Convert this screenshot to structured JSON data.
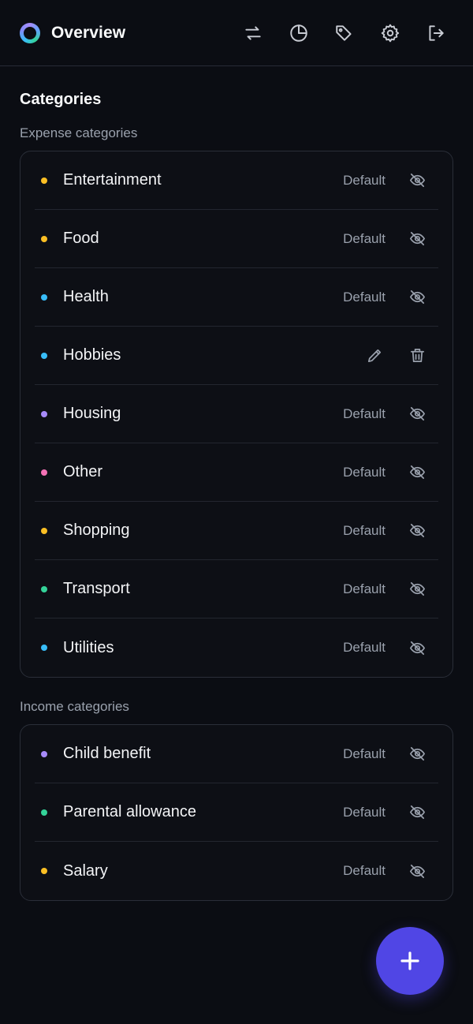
{
  "header": {
    "title": "Overview",
    "icons": [
      "transactions-icon",
      "pie-chart-icon",
      "tag-icon",
      "settings-icon",
      "logout-icon"
    ]
  },
  "page": {
    "title": "Categories"
  },
  "colors": {
    "yellow": "#fbbf24",
    "blue": "#38bdf8",
    "purple": "#a78bfa",
    "pink": "#f472b6",
    "green": "#34d399",
    "accent": "#5046e5"
  },
  "expense": {
    "label": "Expense categories",
    "items": [
      {
        "name": "Entertainment",
        "tag": "Default",
        "color": "#fbbf24",
        "default": true
      },
      {
        "name": "Food",
        "tag": "Default",
        "color": "#fbbf24",
        "default": true
      },
      {
        "name": "Health",
        "tag": "Default",
        "color": "#38bdf8",
        "default": true
      },
      {
        "name": "Hobbies",
        "tag": "",
        "color": "#38bdf8",
        "default": false
      },
      {
        "name": "Housing",
        "tag": "Default",
        "color": "#a78bfa",
        "default": true
      },
      {
        "name": "Other",
        "tag": "Default",
        "color": "#f472b6",
        "default": true
      },
      {
        "name": "Shopping",
        "tag": "Default",
        "color": "#fbbf24",
        "default": true
      },
      {
        "name": "Transport",
        "tag": "Default",
        "color": "#34d399",
        "default": true
      },
      {
        "name": "Utilities",
        "tag": "Default",
        "color": "#38bdf8",
        "default": true
      }
    ]
  },
  "income": {
    "label": "Income categories",
    "items": [
      {
        "name": "Child benefit",
        "tag": "Default",
        "color": "#a78bfa",
        "default": true
      },
      {
        "name": "Parental allowance",
        "tag": "Default",
        "color": "#34d399",
        "default": true
      },
      {
        "name": "Salary",
        "tag": "Default",
        "color": "#fbbf24",
        "default": true
      }
    ]
  }
}
